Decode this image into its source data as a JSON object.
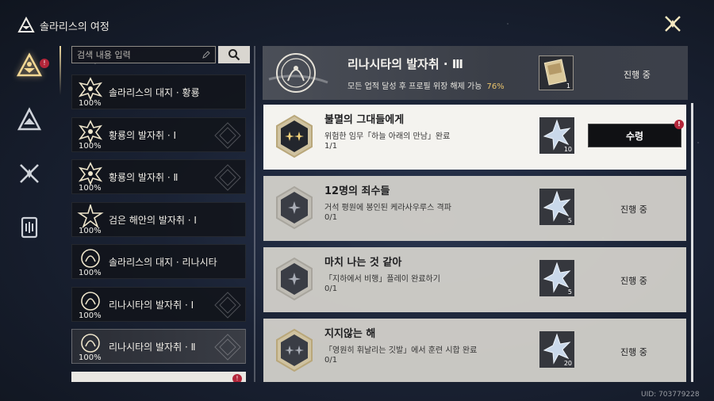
{
  "header": {
    "title": "솔라리스의 여정"
  },
  "nav": {
    "items": [
      {
        "icon": "journey-emblem-icon",
        "badge": "!"
      },
      {
        "icon": "triangle-emblem-icon"
      },
      {
        "icon": "crossed-swords-icon"
      },
      {
        "icon": "archive-book-icon"
      }
    ]
  },
  "search": {
    "placeholder": "검색 내용 입력",
    "value": ""
  },
  "journeys": [
    {
      "label": "솔라리스의 대지 · 황룡",
      "progress": "100%"
    },
    {
      "label": "황룡의 발자취 · Ⅰ",
      "progress": "100%"
    },
    {
      "label": "황룡의 발자취 · Ⅱ",
      "progress": "100%"
    },
    {
      "label": "검은 해안의 발자취 · Ⅰ",
      "progress": "100%"
    },
    {
      "label": "솔라리스의 대지 · 리나시타",
      "progress": "100%"
    },
    {
      "label": "리나시타의 발자취 · Ⅰ",
      "progress": "100%"
    },
    {
      "label": "리나시타의 발자취 · Ⅱ",
      "progress": "100%"
    }
  ],
  "partial_item_badge": "!",
  "main": {
    "title": "리나시타의 발자취 · Ⅲ",
    "description": "모든 업적 달성 후 프로필 위장 해제 가능",
    "percent": "76%",
    "reward_qty": "1",
    "status": "진행 중"
  },
  "quests": [
    {
      "title": "불멸의 그대들에게",
      "description": "위험한 임무「하늘 아래의 만남」완료",
      "progress": "1/1",
      "reward_qty": "10",
      "completed": true,
      "action": "수령",
      "badge": "!"
    },
    {
      "title": "12명의 죄수들",
      "description": "거석 평원에 봉인된 케라사우루스 격파",
      "progress": "0/1",
      "reward_qty": "5",
      "completed": false,
      "status": "진행 중"
    },
    {
      "title": "마치 나는 것 같아",
      "description": "「지하에서 비행」플레이 완료하기",
      "progress": "0/1",
      "reward_qty": "5",
      "completed": false,
      "status": "진행 중"
    },
    {
      "title": "지지않는 해",
      "description": "「영원히 휘날리는 깃발」에서 훈련 시합 완료",
      "progress": "0/1",
      "reward_qty": "20",
      "completed": false,
      "status": "진행 중"
    }
  ],
  "uid": "UID: 703779228",
  "colors": {
    "accent_gold": "#e9c36c",
    "badge_red": "#b3263a",
    "panel_light": "#d6d4ce"
  }
}
